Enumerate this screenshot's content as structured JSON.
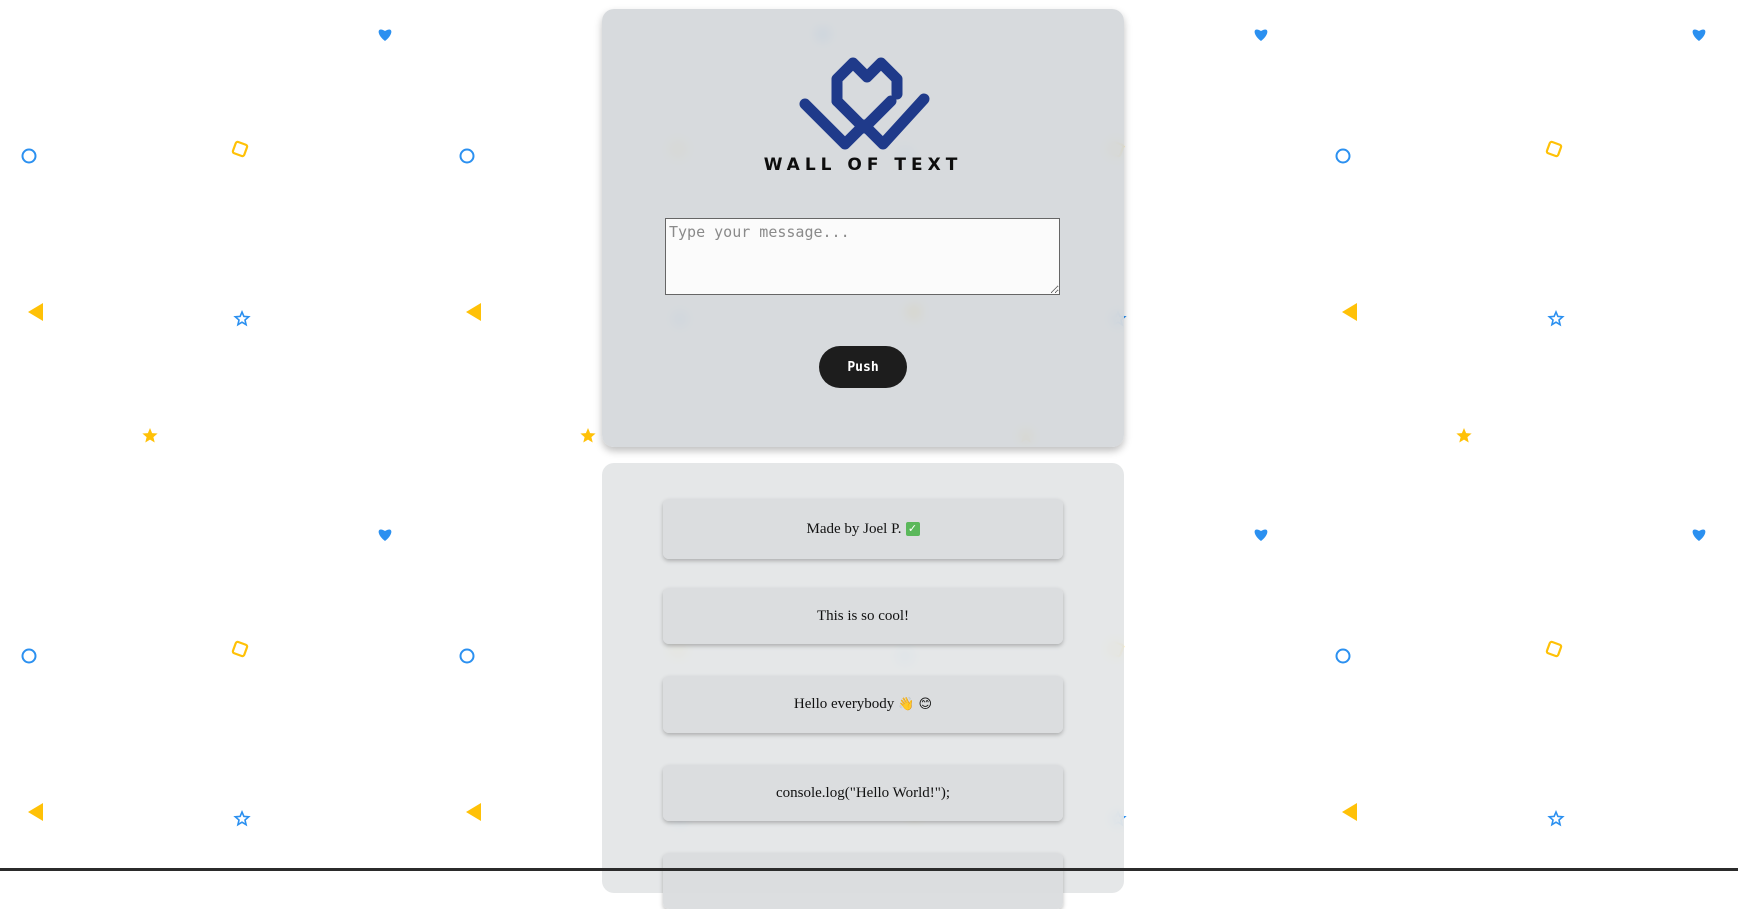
{
  "brand": {
    "title": "WALL OF TEXT",
    "logo_color": "#1f3a8a"
  },
  "composer": {
    "placeholder": "Type your message...",
    "value": "",
    "push_label": "Push"
  },
  "posts": [
    {
      "text": "Made by Joel P.",
      "emoji": "check-mark-emoji"
    },
    {
      "text": "This is so cool!"
    },
    {
      "text": "Hello everybody",
      "emoji": "waving-hand-and-smile-emoji"
    },
    {
      "text": "console.log(\"Hello World!\");"
    }
  ],
  "background": {
    "pattern_icons": [
      "heart-icon",
      "circle-icon",
      "square-icon",
      "triangle-icon",
      "star-icon"
    ],
    "blue": "#2b90f0",
    "yellow": "#ffc107"
  }
}
